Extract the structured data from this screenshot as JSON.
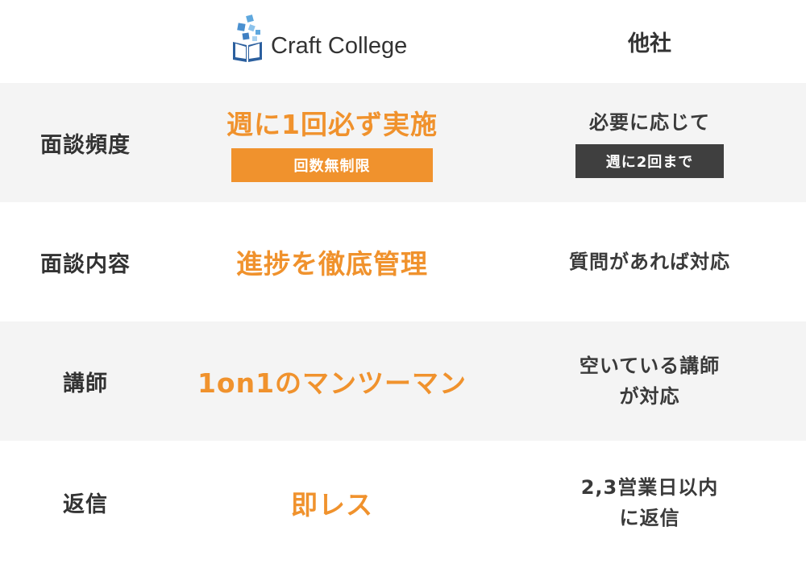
{
  "header": {
    "logo_name": "Craft College",
    "logo_icon": "book-cubes-logo-icon",
    "other_label": "他社"
  },
  "rows": [
    {
      "label": "面談頻度",
      "ours": "週に1回必ず実施",
      "ours_badge": "回数無制限",
      "other": "必要に応じて",
      "other_badge": "週に2回まで"
    },
    {
      "label": "面談内容",
      "ours": "進捗を徹底管理",
      "other": "質問があれば対応"
    },
    {
      "label": "講師",
      "ours": "1on1のマンツーマン",
      "other_lines": [
        "空いている講師",
        "が対応"
      ]
    },
    {
      "label": "返信",
      "ours": "即レス",
      "other_lines": [
        "2,3営業日以内",
        "に返信"
      ]
    }
  ],
  "colors": {
    "accent_orange": "#f0922d",
    "dark_badge": "#3f3f3f",
    "row_shade": "#f4f4f4",
    "text": "#333333",
    "logo_blue": "#2b5f9e"
  }
}
